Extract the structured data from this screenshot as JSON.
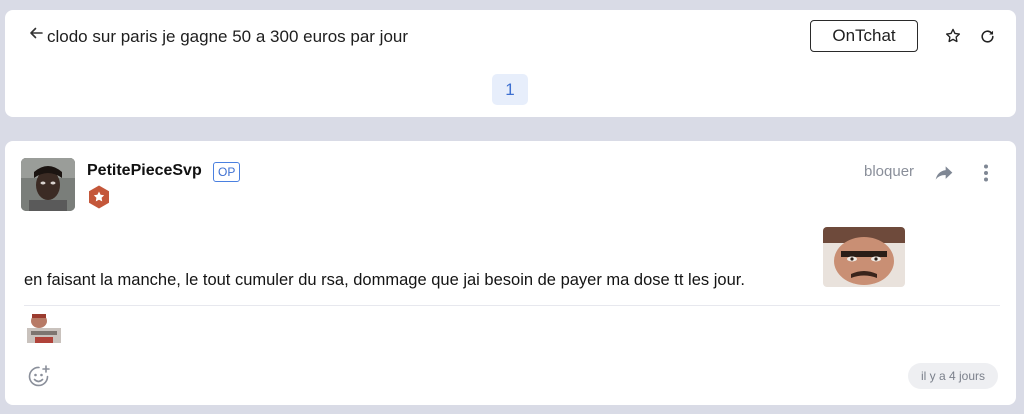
{
  "topic": {
    "title": "clodo sur paris je gagne 50 a 300 euros par jour",
    "ontchat_label": "OnTchat",
    "current_page": "1"
  },
  "post": {
    "author": "PetitePieceSvp",
    "op_label": "OP",
    "block_label": "bloquer",
    "body": "en faisant la manche, le tout cumuler du rsa, dommage que jai besoin de payer ma dose tt les jour.",
    "timestamp": "il y a 4 jours"
  },
  "icons": {
    "back": "arrow-left-icon",
    "favorite": "star-icon",
    "refresh": "refresh-icon",
    "share": "share-arrow-icon",
    "more": "more-vertical-icon",
    "add_reaction": "add-emoji-icon",
    "rank": "star-badge-icon"
  },
  "colors": {
    "background": "#d9dbe6",
    "card": "#ffffff",
    "accent": "#3d6fd1",
    "page_pill": "#e7eefb",
    "rank_badge": "#c4573a",
    "muted": "#8a8f9a"
  }
}
